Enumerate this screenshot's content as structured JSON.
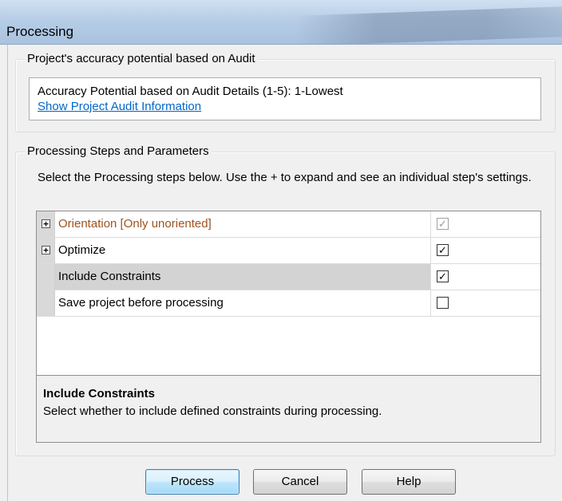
{
  "window": {
    "title": "Processing"
  },
  "audit_group": {
    "title": "Project's accuracy potential based on Audit",
    "accuracy_text": "Accuracy Potential based on Audit Details (1-5): 1-Lowest",
    "link_text": "Show Project Audit Information"
  },
  "steps_group": {
    "title": "Processing Steps and Parameters",
    "instructions": "Select the Processing steps below. Use the + to expand and see an individual step's settings.",
    "rows": [
      {
        "label": "Orientation [Only unoriented]",
        "expandable": true,
        "checked": true,
        "enabled": false,
        "label_color": "#a0521e"
      },
      {
        "label": "Optimize",
        "expandable": true,
        "checked": true,
        "enabled": true,
        "label_color": "#000000"
      },
      {
        "label": "Include Constraints",
        "expandable": false,
        "checked": true,
        "enabled": true,
        "selected": true,
        "label_color": "#000000"
      },
      {
        "label": "Save project before processing",
        "expandable": false,
        "checked": false,
        "enabled": true,
        "label_color": "#000000"
      }
    ],
    "help_title": "Include Constraints",
    "help_description": "Select whether to include defined constraints during processing."
  },
  "buttons": {
    "process": "Process",
    "cancel": "Cancel",
    "help": "Help"
  },
  "icons": {
    "expander": "plus-box-icon",
    "check": "checkmark-icon"
  },
  "glyphs": {
    "plus": "+",
    "check": "✓"
  }
}
